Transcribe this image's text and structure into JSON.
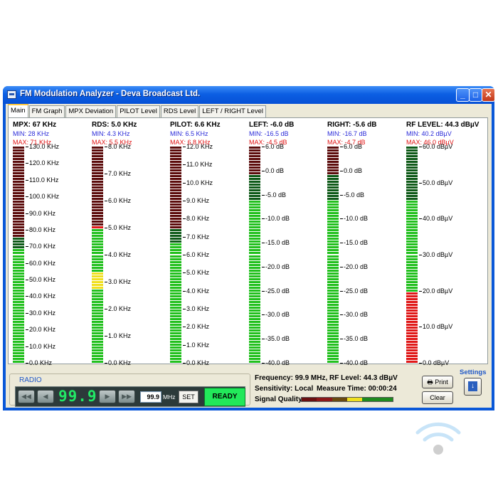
{
  "window": {
    "title": "FM Modulation Analyzer - Deva Broadcast Ltd.",
    "controls": {
      "minimize": "_",
      "maximize": "□",
      "close": "✕"
    }
  },
  "tabs": [
    {
      "label": "Main",
      "active": true
    },
    {
      "label": "FM Graph",
      "active": false
    },
    {
      "label": "MPX Deviation",
      "active": false
    },
    {
      "label": "PILOT Level",
      "active": false
    },
    {
      "label": "RDS Level",
      "active": false
    },
    {
      "label": "LEFT / RIGHT Level",
      "active": false
    }
  ],
  "meters": [
    {
      "id": "mpx",
      "title": "MPX:  67 KHz",
      "min": "MIN:  28 KHz",
      "max": "MAX:  71 KHz",
      "scale_min": 0,
      "scale_max": 130,
      "level": 67,
      "red_from": 75,
      "yellow_from": null,
      "yellow_to": null,
      "ticks": [
        "130.0 KHz",
        "120.0 KHz",
        "110.0 KHz",
        "100.0 KHz",
        "90.0 KHz",
        "80.0 KHz",
        "70.0 KHz",
        "60.0 KHz",
        "50.0 KHz",
        "40.0 KHz",
        "30.0 KHz",
        "20.0 KHz",
        "10.0 KHz",
        "0.0 KHz"
      ]
    },
    {
      "id": "rds",
      "title": "RDS: 5.0 KHz",
      "min": "MIN: 4.3 KHz",
      "max": "MAX: 5.5 KHz",
      "scale_min": 0,
      "scale_max": 8,
      "level": 5.0,
      "red_from": 5,
      "yellow_from": 2.7,
      "yellow_to": 3.4,
      "ticks": [
        "8.0 KHz",
        "7.0 KHz",
        "6.0 KHz",
        "5.0 KHz",
        "4.0 KHz",
        "3.0 KHz",
        "2.0 KHz",
        "1.0 KHz",
        "0.0 KHz"
      ]
    },
    {
      "id": "pilot",
      "title": "PILOT: 6.6 KHz",
      "min": "MIN: 6.5 KHz",
      "max": "MAX: 6.8 KHz",
      "scale_min": 0,
      "scale_max": 12,
      "level": 6.6,
      "red_from": 7.5,
      "yellow_from": null,
      "yellow_to": null,
      "ticks": [
        "12.0 KHz",
        "11.0 KHz",
        "10.0 KHz",
        "9.0 KHz",
        "8.0 KHz",
        "7.0 KHz",
        "6.0 KHz",
        "5.0 KHz",
        "4.0 KHz",
        "3.0 KHz",
        "2.0 KHz",
        "1.0 KHz",
        "0.0 KHz"
      ]
    },
    {
      "id": "left",
      "title": "LEFT: -6.0 dB",
      "min": "MIN: -16.5 dB",
      "max": "MAX: -4.5 dB",
      "scale_min": -40,
      "scale_max": 6,
      "level": -6.0,
      "red_from": 0,
      "yellow_from": null,
      "yellow_to": null,
      "ticks": [
        "6.0 dB",
        "0.0 dB",
        "-5.0 dB",
        "-10.0 dB",
        "-15.0 dB",
        "-20.0 dB",
        "-25.0 dB",
        "-30.0 dB",
        "-35.0 dB",
        "-40.0 dB"
      ]
    },
    {
      "id": "right",
      "title": "RIGHT: -5.6 dB",
      "min": "MIN: -16.7 dB",
      "max": "MAX: -4.7 dB",
      "scale_min": -40,
      "scale_max": 6,
      "level": -5.6,
      "red_from": 0,
      "yellow_from": null,
      "yellow_to": null,
      "ticks": [
        "6.0 dB",
        "0.0 dB",
        "-5.0 dB",
        "-10.0 dB",
        "-15.0 dB",
        "-20.0 dB",
        "-25.0 dB",
        "-30.0 dB",
        "-35.0 dB",
        "-40.0 dB"
      ]
    },
    {
      "id": "rf",
      "title": "RF LEVEL: 44.3 dBµV",
      "min": "MIN: 40.2 dBµV",
      "max": "MAX: 46.0 dBµV",
      "scale_min": 0,
      "scale_max": 60,
      "level": 44.3,
      "red_from": null,
      "yellow_from": null,
      "yellow_to": null,
      "low_red_to": 20,
      "ticks": [
        "60.0 dBµV",
        "50.0 dBµV",
        "40.0 dBµV",
        "30.0 dBµV",
        "20.0 dBµV",
        "10.0 dBµV",
        "0.0 dBµV"
      ]
    }
  ],
  "colors": {
    "green_on": "#22c01e",
    "green_off": "#0e5a18",
    "red_on": "#e01818",
    "red_off": "#5c0c0c",
    "yellow_on": "#f0e020",
    "yellow_off": "#6a5c10"
  },
  "radio": {
    "legend": "RADIO",
    "frequency_display": "99.9",
    "freq_input": "99.9",
    "unit": "MHz",
    "set_label": "SET",
    "status": "READY",
    "buttons": {
      "seek_back": "◀◀",
      "step_back": "◀",
      "step_forward": "▶",
      "seek_forward": "▶▶"
    }
  },
  "info": {
    "frequency_line": "Frequency: 99.9 MHz, RF Level: 44.3 dBµV",
    "sensitivity_line": "Sensitivity: Local",
    "measure_line": "Measure Time: 00:00:24",
    "signal_quality_label": "Signal Quality:",
    "signal_quality_colors": [
      "#6a1010",
      "#8c1818",
      "#6a4a10",
      "#f0e020",
      "#1e8a1e",
      "#1e8a1e"
    ]
  },
  "actions": {
    "print_label": "Print",
    "clear_label": "Clear",
    "settings_label": "Settings",
    "settings_icon": "↓"
  }
}
